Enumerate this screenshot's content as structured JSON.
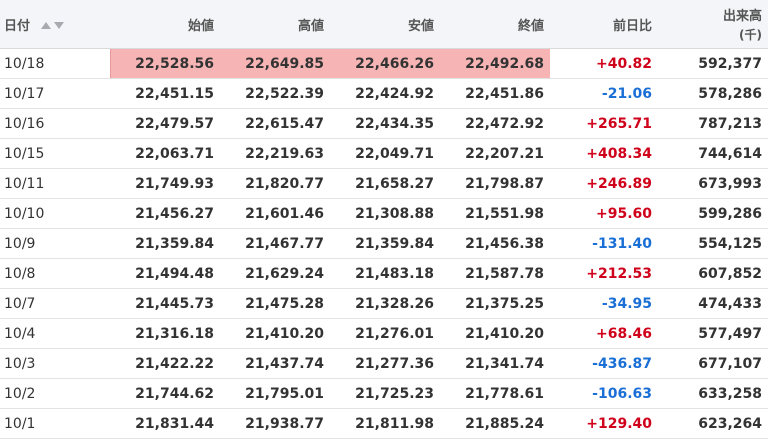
{
  "headers": {
    "date": "日付",
    "open": "始値",
    "high": "高値",
    "low": "安値",
    "close": "終値",
    "change": "前日比",
    "volume": "出来高",
    "volume_unit": "(千)"
  },
  "rows": [
    {
      "date": "10/18",
      "open": "22,528.56",
      "high": "22,649.85",
      "low": "22,466.26",
      "close": "22,492.68",
      "change": "+40.82",
      "volume": "592,377"
    },
    {
      "date": "10/17",
      "open": "22,451.15",
      "high": "22,522.39",
      "low": "22,424.92",
      "close": "22,451.86",
      "change": "-21.06",
      "volume": "578,286"
    },
    {
      "date": "10/16",
      "open": "22,479.57",
      "high": "22,615.47",
      "low": "22,434.35",
      "close": "22,472.92",
      "change": "+265.71",
      "volume": "787,213"
    },
    {
      "date": "10/15",
      "open": "22,063.71",
      "high": "22,219.63",
      "low": "22,049.71",
      "close": "22,207.21",
      "change": "+408.34",
      "volume": "744,614"
    },
    {
      "date": "10/11",
      "open": "21,749.93",
      "high": "21,820.77",
      "low": "21,658.27",
      "close": "21,798.87",
      "change": "+246.89",
      "volume": "673,993"
    },
    {
      "date": "10/10",
      "open": "21,456.27",
      "high": "21,601.46",
      "low": "21,308.88",
      "close": "21,551.98",
      "change": "+95.60",
      "volume": "599,286"
    },
    {
      "date": "10/9",
      "open": "21,359.84",
      "high": "21,467.77",
      "low": "21,359.84",
      "close": "21,456.38",
      "change": "-131.40",
      "volume": "554,125"
    },
    {
      "date": "10/8",
      "open": "21,494.48",
      "high": "21,629.24",
      "low": "21,483.18",
      "close": "21,587.78",
      "change": "+212.53",
      "volume": "607,852"
    },
    {
      "date": "10/7",
      "open": "21,445.73",
      "high": "21,475.28",
      "low": "21,328.26",
      "close": "21,375.25",
      "change": "-34.95",
      "volume": "474,433"
    },
    {
      "date": "10/4",
      "open": "21,316.18",
      "high": "21,410.20",
      "low": "21,276.01",
      "close": "21,410.20",
      "change": "+68.46",
      "volume": "577,497"
    },
    {
      "date": "10/3",
      "open": "21,422.22",
      "high": "21,437.74",
      "low": "21,277.36",
      "close": "21,341.74",
      "change": "-436.87",
      "volume": "677,107"
    },
    {
      "date": "10/2",
      "open": "21,744.62",
      "high": "21,795.01",
      "low": "21,725.23",
      "close": "21,778.61",
      "change": "-106.63",
      "volume": "633,258"
    },
    {
      "date": "10/1",
      "open": "21,831.44",
      "high": "21,938.77",
      "low": "21,811.98",
      "close": "21,885.24",
      "change": "+129.40",
      "volume": "623,264"
    }
  ],
  "highlighted_row_index": 0,
  "colors": {
    "up": "#d0021b",
    "down": "#1a6fd6",
    "highlight": "#f7b4b4",
    "header_bg": "#f4f5f8"
  }
}
